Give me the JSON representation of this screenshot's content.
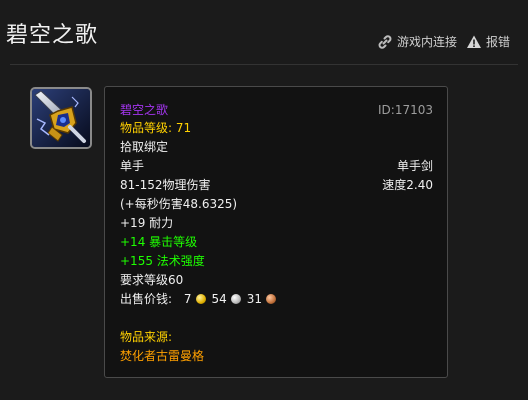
{
  "page": {
    "title": "碧空之歌"
  },
  "actions": {
    "link_label": "游戏内连接",
    "report_label": "报错"
  },
  "icons": {
    "link": "link-icon",
    "report": "warning-icon",
    "item": "sword-item-icon"
  },
  "colors": {
    "epic": "#a335ee",
    "label_gold": "#ffd100",
    "green_stat": "#1eff00",
    "source_orange": "#ffa000"
  },
  "tooltip": {
    "name": "碧空之歌",
    "id": "ID:17103",
    "item_level": "物品等级: 71",
    "bind": "拾取绑定",
    "slot": "单手",
    "weapon_type": "单手剑",
    "damage": "81-152物理伤害",
    "speed": "速度2.40",
    "dps": "(+每秒伤害48.6325)",
    "stamina": "+19 耐力",
    "crit": "+14 暴击等级",
    "spell_power": "+155 法术强度",
    "required_level": "要求等级60",
    "sell_label": "出售价钱:",
    "sell_gold": "7",
    "sell_silver": "54",
    "sell_copper": "31",
    "source_label": "物品来源:",
    "source_value": "焚化者古雷曼格"
  }
}
